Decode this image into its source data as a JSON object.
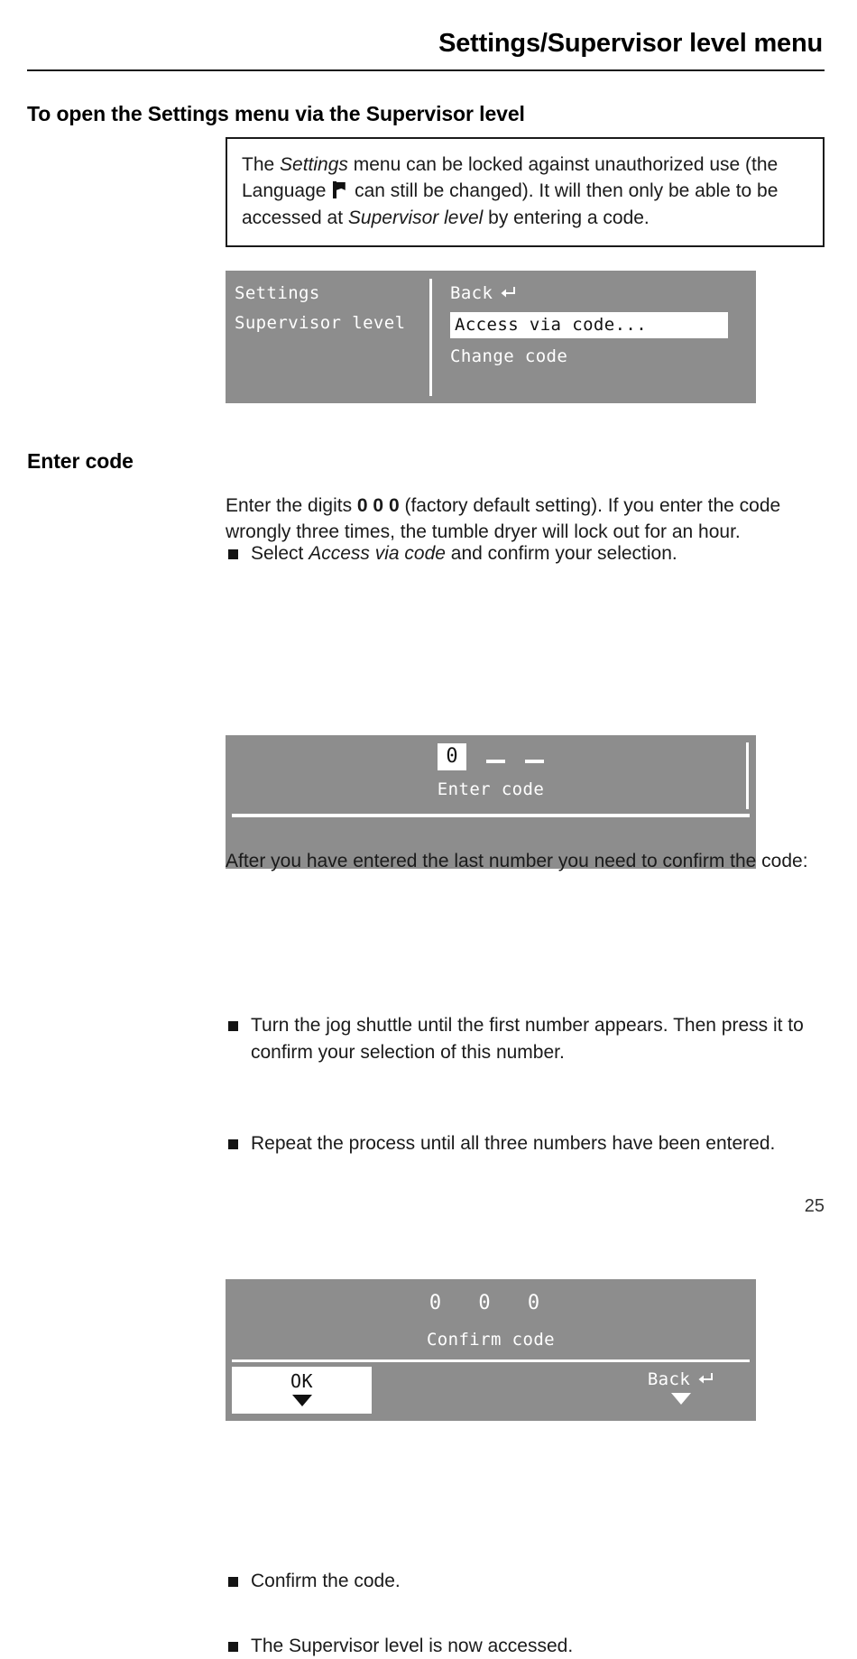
{
  "header": {
    "title": "Settings/Supervisor level menu"
  },
  "sections": {
    "open_settings_heading": "To open the Settings menu via the Supervisor level",
    "enter_code_heading": "Enter code"
  },
  "note_box": {
    "line1_a": "The ",
    "line1_italic": "Settings",
    "line1_b": " menu can be locked against unauthorized use (the Language ",
    "flag_icon": "flag-icon",
    "line1_c": " can still be changed). It will then only be able to be accessed at ",
    "line2_italic": "Supervisor level",
    "line1_d": " by entering a code."
  },
  "lcd_settings": {
    "left": {
      "title": "Settings",
      "subtitle": "Supervisor level"
    },
    "right": {
      "back_label": "Back",
      "back_icon": "enter-return-icon",
      "selected_item": "Access via code...",
      "change_code": "Change code"
    }
  },
  "bullet_select": {
    "prefix": "Select ",
    "italic": "Access via code",
    "suffix": " and confirm your selection."
  },
  "enter_code_paragraph": {
    "prefix": "Enter the digits ",
    "bold_digits": "0 0 0",
    "suffix": " (factory default setting). If you enter the code wrongly three times, the tumble dryer will lock out for an hour."
  },
  "lcd_enter_code": {
    "active_digit": "0",
    "caption": "Enter code"
  },
  "bullets_middle": [
    "Turn the jog shuttle until the first number appears. Then press it to confirm your selection of this number.",
    "Repeat the process until all three numbers have been entered."
  ],
  "confirm_paragraph": "After you have entered the last number you need to confirm the code:",
  "lcd_confirm_code": {
    "digits": "0 0 0",
    "caption": "Confirm code",
    "ok_label": "OK",
    "ok_arrow_icon": "triangle-down-icon",
    "back_label": "Back",
    "back_icon": "enter-return-icon",
    "back_arrow_icon": "triangle-down-icon"
  },
  "bullets_end": [
    "Confirm the code.",
    "The Supervisor level is now accessed."
  ],
  "footer": {
    "page_number": "25"
  },
  "colors": {
    "lcd_background": "#8d8d8d",
    "lcd_text": "#ffffff",
    "ink": "#1a1a1a"
  }
}
